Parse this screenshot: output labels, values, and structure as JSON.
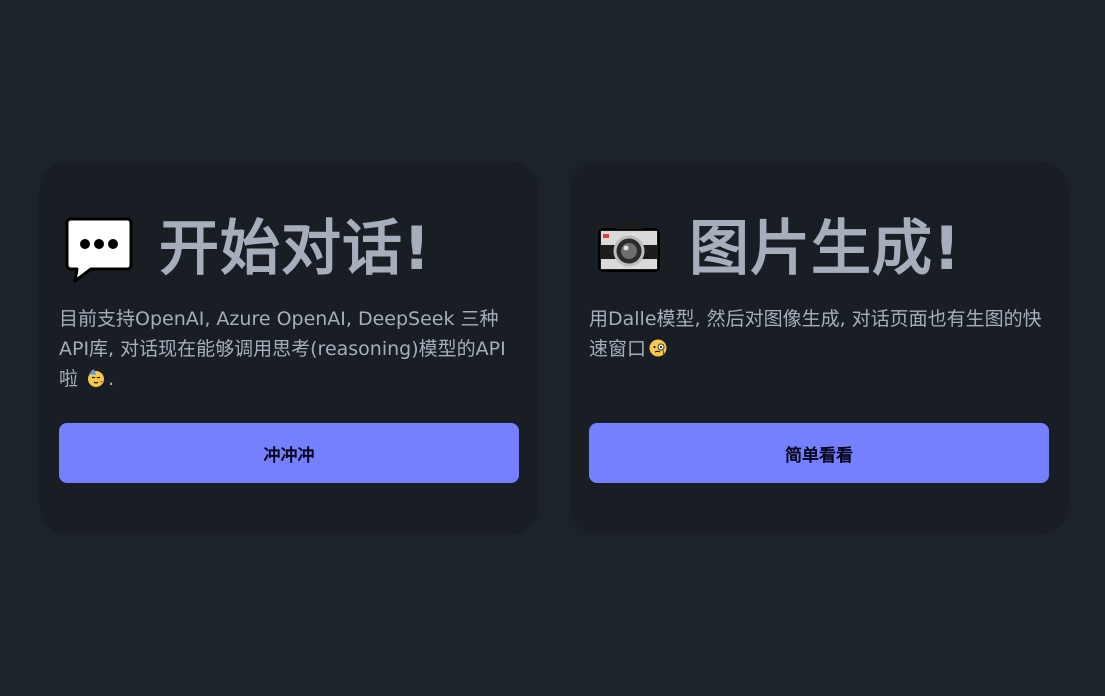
{
  "colors": {
    "page_background": "#1d232a",
    "card_background": "#191e24",
    "text": "#a6adbb",
    "primary_button": "#7480ff",
    "primary_button_text": "#050617"
  },
  "cards": [
    {
      "icon": "speech-balloon-icon",
      "title": "开始对话!",
      "description_before_emoji": "目前支持OpenAI, Azure OpenAI, DeepSeek 三种API库, 对话现在能够调用思考(reasoning)模型的API啦",
      "description_emoji": "partying-face-icon",
      "description_after_emoji": ".",
      "button_label": "冲冲冲"
    },
    {
      "icon": "camera-icon",
      "title": "图片生成!",
      "description_before_emoji": "用Dalle模型, 然后对图像生成, 对话页面也有生图的快速窗口",
      "description_emoji": "face-with-monocle-icon",
      "description_after_emoji": "",
      "button_label": "简单看看"
    }
  ]
}
